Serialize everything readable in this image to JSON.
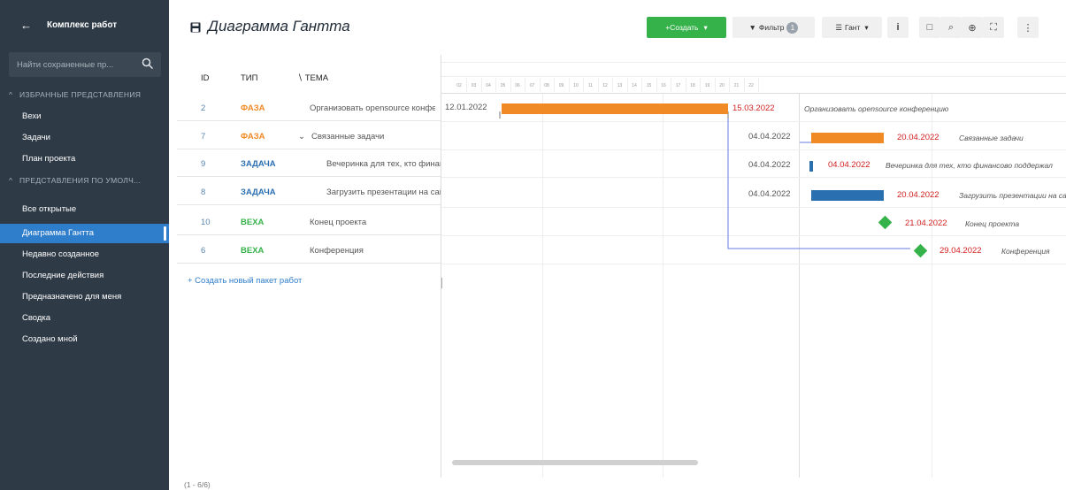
{
  "sidebar": {
    "project_name": "Комплекс работ",
    "search_placeholder": "Найти сохраненные пр...",
    "section_favorites": "ИЗБРАННЫЕ ПРЕДСТАВЛЕНИЯ",
    "favorites": [
      "Вехи",
      "Задачи",
      "План проекта"
    ],
    "section_defaults": "ПРЕДСТАВЛЕНИЯ ПО УМОЛЧ...",
    "defaults": [
      "Все открытые",
      "Диаграмма Гантта",
      "Недавно созданное",
      "Последние действия",
      "Предназначено для меня",
      "Сводка",
      "Создано мной"
    ],
    "active_item": "Диаграмма Гантта"
  },
  "header": {
    "title": "Диаграмма Гантта",
    "create_label": "+Создать",
    "filter_label": "Фильтр",
    "filter_count": "1",
    "view_label": "Гант"
  },
  "table": {
    "col_id": "ID",
    "col_type": "ТИП",
    "col_subject": "ТЕМА",
    "rows": [
      {
        "id": "2",
        "type": "ФАЗА",
        "subject": "Организовать opensource конференцию"
      },
      {
        "id": "7",
        "type": "ФАЗА",
        "subject": "Связанные задачи"
      },
      {
        "id": "9",
        "type": "ЗАДАЧА",
        "subject": "Вечеринка для тех, кто финансово поддержал"
      },
      {
        "id": "8",
        "type": "ЗАДАЧА",
        "subject": "Загрузить презентации на сайт"
      },
      {
        "id": "10",
        "type": "ВЕХА",
        "subject": "Конец проекта"
      },
      {
        "id": "6",
        "type": "ВЕХА",
        "subject": "Конференция"
      }
    ],
    "add_label": "+ Создать новый пакет работ",
    "count_label": "(1 - 6/6)"
  },
  "gantt": {
    "day_numbers": [
      "02",
      "03",
      "04",
      "05",
      "06",
      "07",
      "08",
      "09",
      "10",
      "11",
      "12",
      "13",
      "14",
      "15",
      "16",
      "17",
      "18",
      "19",
      "20",
      "21",
      "22"
    ],
    "start_label_row0": "12.01.2022",
    "items": [
      {
        "start": "",
        "end": "15.03.2022",
        "caption": "Организовать opensource конференцию"
      },
      {
        "start": "04.04.2022",
        "end": "20.04.2022",
        "caption": "Связанные задачи"
      },
      {
        "start": "04.04.2022",
        "end": "04.04.2022",
        "caption": "Вечеринка для тех, кто финансово поддержал"
      },
      {
        "start": "04.04.2022",
        "end": "20.04.2022",
        "caption": "Загрузить презентации на сайт"
      },
      {
        "start": "",
        "end": "21.04.2022",
        "caption": "Конец проекта"
      },
      {
        "start": "",
        "end": "29.04.2022",
        "caption": "Конференция"
      }
    ]
  },
  "colors": {
    "phase": "#f08a24",
    "task": "#2a6fb0",
    "milestone": "#35b24a",
    "date_red": "#d11f1f",
    "active_nav": "#2f7ecb"
  }
}
